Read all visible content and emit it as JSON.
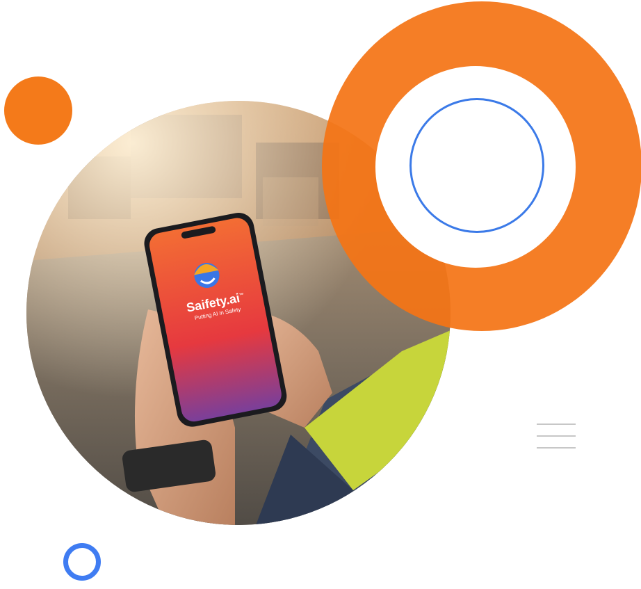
{
  "brand": {
    "app_name": "Saifety.ai",
    "trademark": "™",
    "tagline": "Putting AI in Safety"
  },
  "colors": {
    "accent_orange": "#f47415",
    "accent_blue": "#3b7ae8",
    "divider_gray": "#c7c7c7"
  },
  "icons": {
    "logo": "hardhat-smiley-icon",
    "menu": "menu-lines-icon"
  }
}
